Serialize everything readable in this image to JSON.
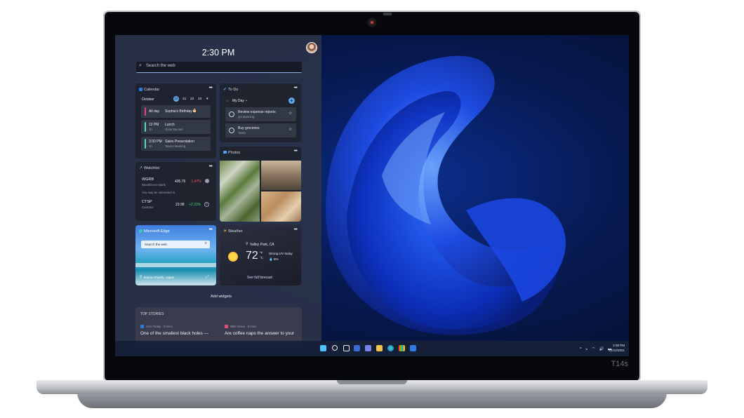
{
  "device": {
    "model_label": "T14s"
  },
  "widgets_panel": {
    "time": "2:30 PM",
    "search_placeholder": "Search the web",
    "add_widgets_label": "Add widgets"
  },
  "calendar": {
    "title": "Calendar",
    "month": "October",
    "days": [
      "20",
      "21",
      "22",
      "23"
    ],
    "events": [
      {
        "time": "All day",
        "duration": "",
        "title": "Sophia's Birthday",
        "sub": "",
        "color": "#e0457b"
      },
      {
        "time": "12 PM",
        "duration": "1h",
        "title": "Lunch",
        "sub": "Omar Bennet",
        "color": "#5ed6c7"
      },
      {
        "time": "3:30 PM",
        "duration": "1h",
        "title": "Sales Presentation",
        "sub": "Teams Meeting",
        "color": "#5ed6c7"
      }
    ]
  },
  "todo": {
    "title": "To Do",
    "list_name": "My Day",
    "items": [
      {
        "title": "Review expense reports",
        "sub": "Q4 planning"
      },
      {
        "title": "Buy groceries",
        "sub": "Tasks"
      }
    ]
  },
  "photos": {
    "title": "Photos"
  },
  "watchlist": {
    "title": "Watchlist",
    "stocks": [
      {
        "symbol": "WGRB",
        "name": "WoodGrove Bank",
        "price": "435.75",
        "change": "-1.47%",
        "change_color": "#ff5a5a"
      },
      {
        "symbol": "CTSP",
        "name": "Contoso",
        "price": "23.98",
        "change": "+2.23%",
        "change_color": "#3bd16f"
      }
    ],
    "note": "You may be interested in"
  },
  "edge": {
    "title": "Microsoft Edge",
    "search_placeholder": "Search the web",
    "location": "Ikema Ohashi, Japan"
  },
  "weather": {
    "title": "Weather",
    "location": "Valley Park, CA",
    "temp": "72",
    "unit_f": "°F",
    "unit_c": "°C",
    "condition": "Strong UV today",
    "precip": "5%",
    "forecast_link": "See full forecast"
  },
  "top_stories": {
    "title": "TOP STORIES",
    "stories": [
      {
        "source": "USA Today · 3 mins",
        "headline": "One of the smallest black holes —"
      },
      {
        "source": "NBC News · 5 mins",
        "headline": "Are coffee naps the answer to your"
      }
    ]
  },
  "taskbar": {
    "clock_time": "2:30 PM",
    "clock_date": "01/12/2021",
    "tray_icons": "^ ◒ ⌔ 🔊 ▬"
  }
}
